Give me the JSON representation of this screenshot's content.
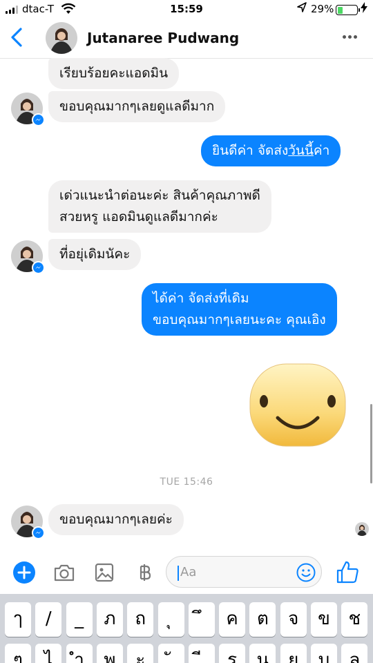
{
  "status_bar": {
    "carrier": "dtac-T",
    "time": "15:59",
    "battery_percent": "29%",
    "battery_level": 0.29,
    "icons": [
      "signal-icon",
      "wifi-icon",
      "location-icon",
      "battery-icon",
      "charging-icon"
    ]
  },
  "header": {
    "contact_name": "Jutanaree Pudwang",
    "icons": [
      "back-icon",
      "avatar",
      "more-icon"
    ]
  },
  "messages": [
    {
      "direction": "in",
      "text": "เรียบร้อยคะแอดมิน",
      "avatar": false
    },
    {
      "direction": "in",
      "text": "ขอบคุณมากๆเลยดูแลดีมาก",
      "avatar": true
    },
    {
      "direction": "out",
      "text_before": "ยินดีค่า จัดส่ง",
      "text_underlined": "วันนี้",
      "text_after": "ค่า"
    },
    {
      "direction": "in",
      "lines": [
        "เด่วแนะนำต่อนะค่ะ สินค้าคุณภาพดี",
        "สวยหรู แอดมินดูแลดีมากค่ะ"
      ],
      "avatar": false
    },
    {
      "direction": "in",
      "text": "ที่อยุ่เดิมนัคะ",
      "avatar": true
    },
    {
      "direction": "out",
      "lines": [
        "ได้ค่า จัดส่งที่เดิม",
        "ขอบคุณมากๆเลยนะคะ คุณเอิง"
      ]
    },
    {
      "direction": "out",
      "sticker": "smiley-emoji"
    },
    {
      "direction": "in",
      "text": "ขอบคุณมากๆเลยค่ะ",
      "avatar": true
    }
  ],
  "timestamp": "TUE 15:46",
  "composer": {
    "placeholder": "Aa",
    "icons": [
      "plus-icon",
      "camera-icon",
      "gallery-icon",
      "baht-icon",
      "emoji-icon",
      "thumbs-up-icon"
    ]
  },
  "keyboard": {
    "row1": [
      "ๅ",
      "/",
      "_",
      "ภ",
      "ถ",
      "ุ",
      "ึ",
      "ค",
      "ต",
      "จ",
      "ข",
      "ช"
    ],
    "row2": [
      "ๆ",
      "ไ",
      "ำ",
      "พ",
      "ะ",
      "ั",
      "ี",
      "ร",
      "น",
      "ย",
      "บ",
      "ล"
    ]
  },
  "colors": {
    "accent": "#0b84ff",
    "incoming_bubble": "#f1f0f0",
    "timestamp": "#a5a5a5",
    "keyboard_bg": "#d1d4da"
  }
}
